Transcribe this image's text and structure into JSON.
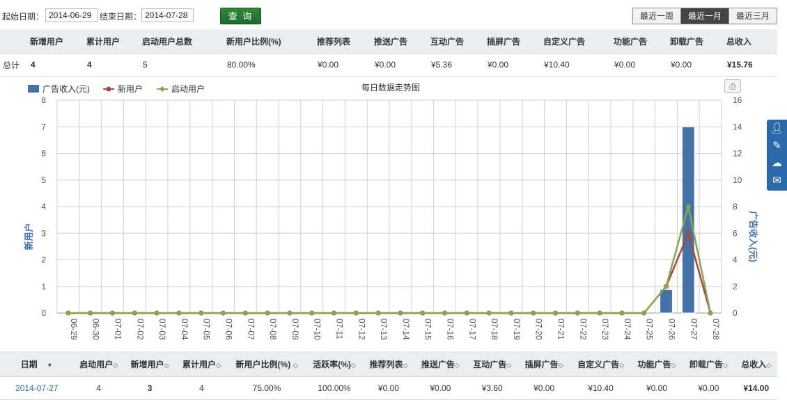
{
  "filters": {
    "start_label": "起始日期：",
    "start_value": "2014-06-29",
    "end_label": "结束日期：",
    "end_value": "2014-07-28",
    "query_label": "查 询"
  },
  "range_buttons": [
    "最近一周",
    "最近一月",
    "最近三月"
  ],
  "range_active": 1,
  "summary": {
    "headers": [
      "",
      "新增用户",
      "累计用户",
      "启动用户总数",
      "新用户比例(%)",
      "推荐列表",
      "推送广告",
      "互动广告",
      "插屏广告",
      "自定义广告",
      "功能广告",
      "卸载广告",
      "总收入"
    ],
    "row": [
      "总计",
      "4",
      "4",
      "5",
      "80.00%",
      "¥0.00",
      "¥0.00",
      "¥5.36",
      "¥0.00",
      "¥10.40",
      "¥0.00",
      "¥0.00",
      "¥15.76"
    ]
  },
  "chart_data": {
    "type": "bar",
    "title": "每日数据走势图",
    "categories": [
      "06-29",
      "06-30",
      "07-01",
      "07-02",
      "07-03",
      "07-04",
      "07-05",
      "07-06",
      "07-07",
      "07-08",
      "07-09",
      "07-10",
      "07-11",
      "07-12",
      "07-13",
      "07-14",
      "07-15",
      "07-16",
      "07-17",
      "07-18",
      "07-19",
      "07-20",
      "07-21",
      "07-22",
      "07-23",
      "07-24",
      "07-25",
      "07-26",
      "07-27",
      "07-28"
    ],
    "ylabel": "新用户",
    "ylim": [
      0,
      8
    ],
    "y_ticks": [
      "0",
      "1",
      "2",
      "3",
      "4",
      "5",
      "6",
      "7",
      "8"
    ],
    "y2label": "广告收入(元)",
    "y2lim": [
      0,
      16
    ],
    "y2_ticks": [
      "0",
      "2",
      "4",
      "6",
      "8",
      "10",
      "12",
      "14",
      "16"
    ],
    "grid": true,
    "legend_position": "top-left",
    "series": [
      {
        "name": "广告收入(元)",
        "type": "bar",
        "axis": "right",
        "color": "#4572a7",
        "values": [
          0,
          0,
          0,
          0,
          0,
          0,
          0,
          0,
          0,
          0,
          0,
          0,
          0,
          0,
          0,
          0,
          0,
          0,
          0,
          0,
          0,
          0,
          0,
          0,
          0,
          0,
          0,
          1.76,
          14.0,
          0
        ]
      },
      {
        "name": "新用户",
        "type": "line",
        "axis": "left",
        "color": "#aa4643",
        "values": [
          0,
          0,
          0,
          0,
          0,
          0,
          0,
          0,
          0,
          0,
          0,
          0,
          0,
          0,
          0,
          0,
          0,
          0,
          0,
          0,
          0,
          0,
          0,
          0,
          0,
          0,
          0,
          1,
          3,
          0
        ]
      },
      {
        "name": "启动用户",
        "type": "line",
        "axis": "left",
        "color": "#89a54e",
        "values": [
          0,
          0,
          0,
          0,
          0,
          0,
          0,
          0,
          0,
          0,
          0,
          0,
          0,
          0,
          0,
          0,
          0,
          0,
          0,
          0,
          0,
          0,
          0,
          0,
          0,
          0,
          0,
          1,
          4,
          0
        ]
      }
    ]
  },
  "detail": {
    "headers": [
      "日期",
      "启动用户",
      "新增用户",
      "累计用户",
      "新用户比例(%)",
      "活跃率(%)",
      "推荐列表",
      "推送广告",
      "互动广告",
      "插屏广告",
      "自定义广告",
      "功能广告",
      "卸载广告",
      "总收入"
    ],
    "sort_glyphs": [
      "▼",
      "◇",
      "◇",
      "◇",
      "◇",
      "◇",
      "◇",
      "◇",
      "◇",
      "◇",
      "◇",
      "◇",
      "◇",
      "◇"
    ],
    "row": [
      "2014-07-27",
      "4",
      "3",
      "4",
      "75.00%",
      "100.00%",
      "¥0.00",
      "¥0.00",
      "¥3.60",
      "¥0.00",
      "¥10.40",
      "¥0.00",
      "¥0.00",
      "¥14.00"
    ]
  },
  "side_icons": [
    "user-icon",
    "edit-icon",
    "wechat-icon",
    "mail-icon"
  ],
  "colors": {
    "accent": "#2a6aa8",
    "query_green": "#1d6a2a",
    "bar": "#4572a7",
    "new_user": "#aa4643",
    "active_user": "#89a54e"
  }
}
